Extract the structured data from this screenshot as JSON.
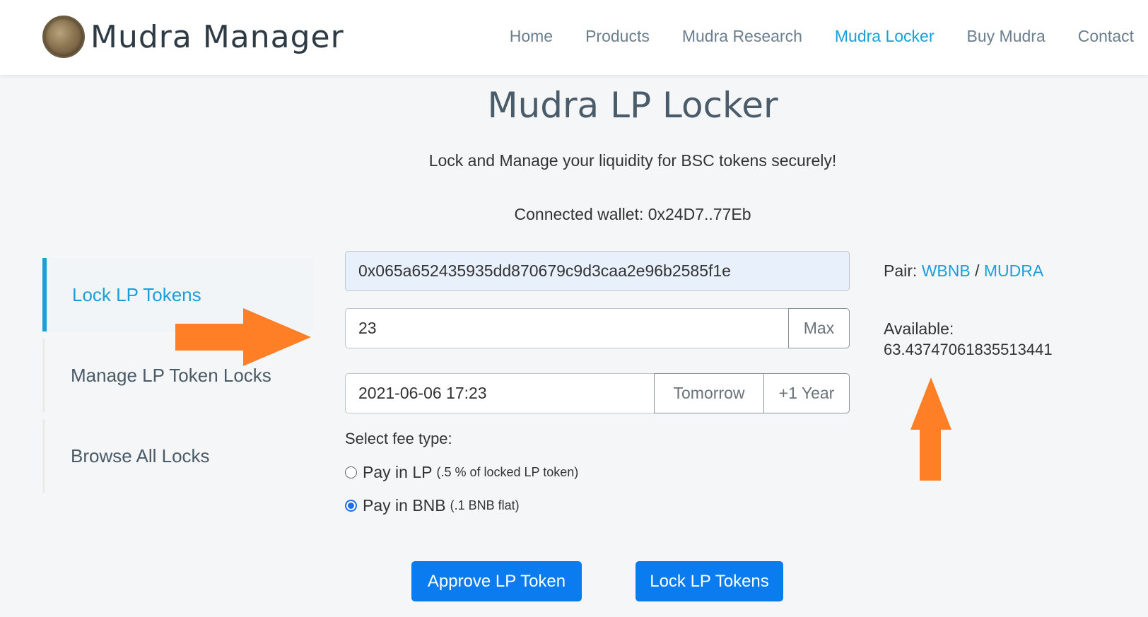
{
  "brand": {
    "name": "Mudra Manager",
    "logo_icon": "coin-logo-icon"
  },
  "nav": [
    {
      "label": "Home",
      "active": false
    },
    {
      "label": "Products",
      "active": false
    },
    {
      "label": "Mudra Research",
      "active": false
    },
    {
      "label": "Mudra Locker",
      "active": true
    },
    {
      "label": "Buy Mudra",
      "active": false
    },
    {
      "label": "Contact",
      "active": false
    }
  ],
  "page": {
    "title": "Mudra LP Locker",
    "subtitle": "Lock and Manage your liquidity for BSC tokens securely!",
    "wallet": "Connected wallet: 0x24D7..77Eb"
  },
  "sidebar": {
    "items": [
      {
        "label": "Lock LP Tokens",
        "active": true
      },
      {
        "label": "Manage LP Token Locks",
        "active": false
      },
      {
        "label": "Browse All Locks",
        "active": false
      }
    ]
  },
  "form": {
    "address_value": "0x065a652435935dd870679c9d3caa2e96b2585f1e",
    "amount_value": "23",
    "max_label": "Max",
    "date_value": "2021-06-06 17:23",
    "tomorrow_label": "Tomorrow",
    "year_label": "+1 Year",
    "fee_label": "Select fee type:",
    "fee_options": [
      {
        "label": "Pay in LP",
        "note": "(.5 % of locked LP token)",
        "checked": false
      },
      {
        "label": "Pay in BNB",
        "note": "(.1 BNB flat)",
        "checked": true
      }
    ],
    "approve_label": "Approve LP Token",
    "lock_label": "Lock LP Tokens"
  },
  "info": {
    "pair_label": "Pair:",
    "pair_token_a": "WBNB",
    "pair_separator": "/",
    "pair_token_b": "MUDRA",
    "available_label": "Available:",
    "available_value": "63.43747061835513441"
  },
  "colors": {
    "accent": "#1a9fd8",
    "primary_button": "#0b7bf0",
    "arrow": "#ff7f27"
  }
}
